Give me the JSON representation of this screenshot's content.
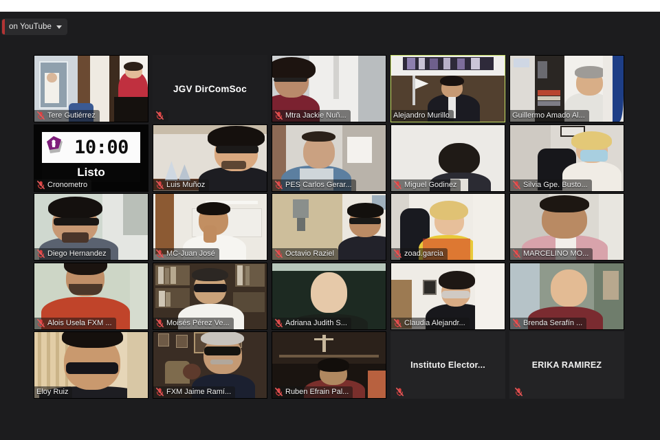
{
  "window": {
    "title": "Zoom Meeting — Gallery View",
    "background_color": "#1c1c1e",
    "active_speaker_border_color": "#c9e265",
    "mic_muted_color": "#d94040"
  },
  "stream_badge": {
    "label": "on YouTube",
    "caret_icon": "chevron-down-icon",
    "record_color": "#b33434"
  },
  "timer": {
    "time": "10:00",
    "status": "Listo",
    "participant_name": "Cronometro",
    "logo_icon": "purple-emblem-icon"
  },
  "gallery": {
    "columns": 5,
    "rows": 5,
    "tiles": [
      {
        "id": 1,
        "name": "Tere Gutiérrez",
        "muted": true,
        "video": true,
        "active": false,
        "type": "video"
      },
      {
        "id": 2,
        "name": "JGV DirComSoc",
        "muted": true,
        "video": false,
        "active": false,
        "type": "name-only-large"
      },
      {
        "id": 3,
        "name": "Mtra Jackie Nuñ...",
        "muted": true,
        "video": true,
        "active": false,
        "type": "video"
      },
      {
        "id": 4,
        "name": "Alejandro Murillo",
        "muted": false,
        "video": true,
        "active": true,
        "type": "video"
      },
      {
        "id": 5,
        "name": "Guillermo Amado Al...",
        "muted": false,
        "video": true,
        "active": false,
        "type": "video"
      },
      {
        "id": 6,
        "name": "Cronometro",
        "muted": true,
        "video": true,
        "active": false,
        "type": "timer"
      },
      {
        "id": 7,
        "name": "Luis Muñoz",
        "muted": true,
        "video": true,
        "active": false,
        "type": "video"
      },
      {
        "id": 8,
        "name": "PES Carlos Gerar...",
        "muted": true,
        "video": true,
        "active": false,
        "type": "video"
      },
      {
        "id": 9,
        "name": "Miguel Godinez",
        "muted": true,
        "video": true,
        "active": false,
        "type": "video"
      },
      {
        "id": 10,
        "name": "Silvia Gpe. Busto...",
        "muted": true,
        "video": true,
        "active": false,
        "type": "video"
      },
      {
        "id": 11,
        "name": "Diego Hernandez",
        "muted": true,
        "video": true,
        "active": false,
        "type": "video"
      },
      {
        "id": 12,
        "name": "MC-Juan José",
        "muted": true,
        "video": true,
        "active": false,
        "type": "video"
      },
      {
        "id": 13,
        "name": "Octavio Raziel",
        "muted": true,
        "video": true,
        "active": false,
        "type": "video"
      },
      {
        "id": 14,
        "name": "zoad.garcia",
        "muted": true,
        "video": true,
        "active": false,
        "type": "video"
      },
      {
        "id": 15,
        "name": "MARCELINO MO...",
        "muted": true,
        "video": true,
        "active": false,
        "type": "video"
      },
      {
        "id": 16,
        "name": "Alois Usela FXM ...",
        "muted": true,
        "video": true,
        "active": false,
        "type": "video"
      },
      {
        "id": 17,
        "name": "Moisés Pérez Ve...",
        "muted": true,
        "video": true,
        "active": false,
        "type": "video"
      },
      {
        "id": 18,
        "name": "Adriana Judith S...",
        "muted": true,
        "video": true,
        "active": false,
        "type": "video"
      },
      {
        "id": 19,
        "name": "Claudia Alejandr...",
        "muted": true,
        "video": true,
        "active": false,
        "type": "video"
      },
      {
        "id": 20,
        "name": "Brenda Serafín ...",
        "muted": true,
        "video": true,
        "active": false,
        "type": "video"
      },
      {
        "id": 21,
        "name": "Eloy Ruiz",
        "muted": false,
        "video": true,
        "active": false,
        "type": "video"
      },
      {
        "id": 22,
        "name": "FXM Jaime Ramí...",
        "muted": true,
        "video": true,
        "active": false,
        "type": "video"
      },
      {
        "id": 23,
        "name": "Ruben Efrain Pal...",
        "muted": true,
        "video": true,
        "active": false,
        "type": "video"
      },
      {
        "id": 24,
        "name": "Instituto  Elector...",
        "muted": true,
        "video": false,
        "active": false,
        "type": "name-only"
      },
      {
        "id": 25,
        "name": "ERIKA RAMIREZ",
        "muted": true,
        "video": false,
        "active": false,
        "type": "name-only"
      }
    ]
  }
}
